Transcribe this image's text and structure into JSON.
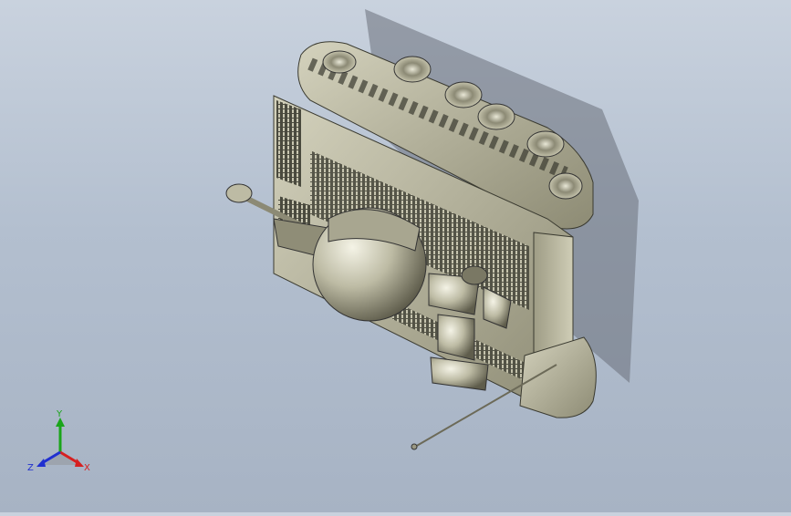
{
  "viewport": {
    "background_top": "#c9d2de",
    "background_bottom": "#a7b3c4",
    "model_color": "#b5b39a",
    "model_shadow": "#6f6c5a"
  },
  "triad": {
    "x_label": "X",
    "y_label": "Y",
    "z_label": "Z",
    "x_color": "#d62020",
    "y_color": "#1aa51a",
    "z_color": "#2030d0"
  }
}
